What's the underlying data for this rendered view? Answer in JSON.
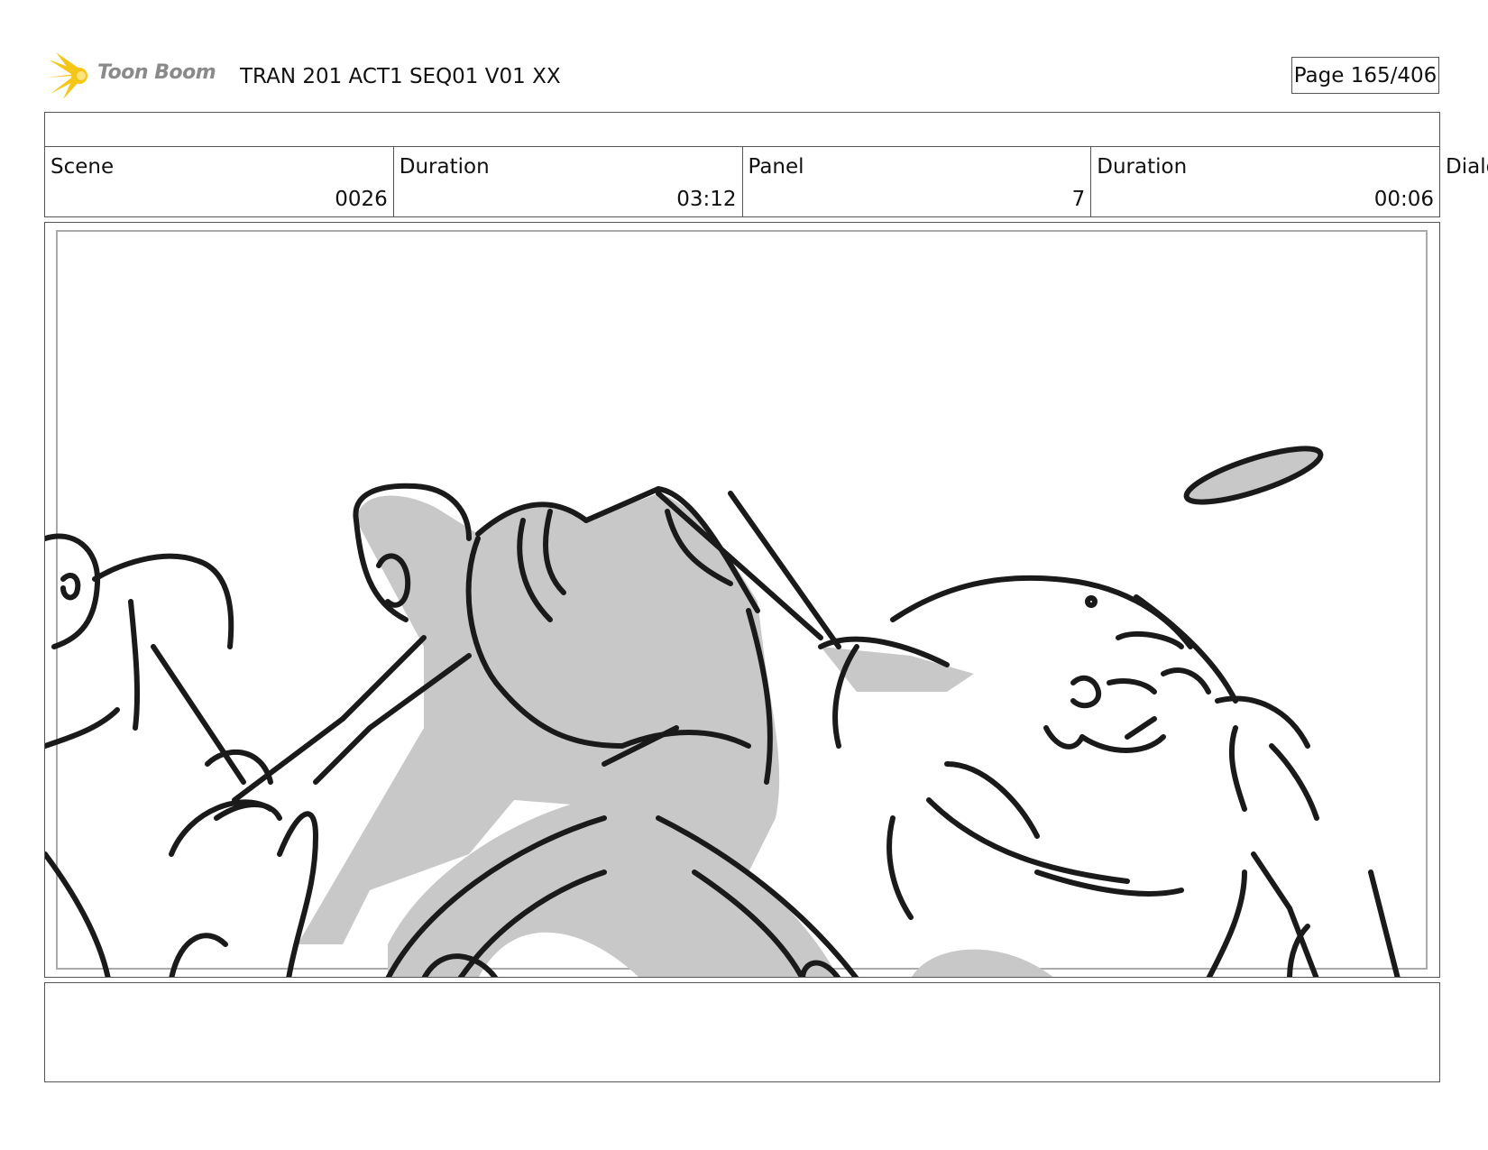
{
  "header": {
    "logo_text": "Toon Boom",
    "title": "TRAN 201 ACT1 SEQ01 V01 XX",
    "page": "Page 165/406"
  },
  "info": {
    "scene_label": "Scene",
    "scene_value": "0026",
    "duration_label": "Duration",
    "duration_value": "03:12",
    "panel_label": "Panel",
    "panel_value": "7",
    "panel_duration_label": "Duration",
    "panel_duration_value": "00:06",
    "dialog_label": "Dialog"
  },
  "colors": {
    "logo_star": "#f5c518",
    "sketch_fill": "#c8c8c8",
    "line": "#1a1a1a"
  }
}
